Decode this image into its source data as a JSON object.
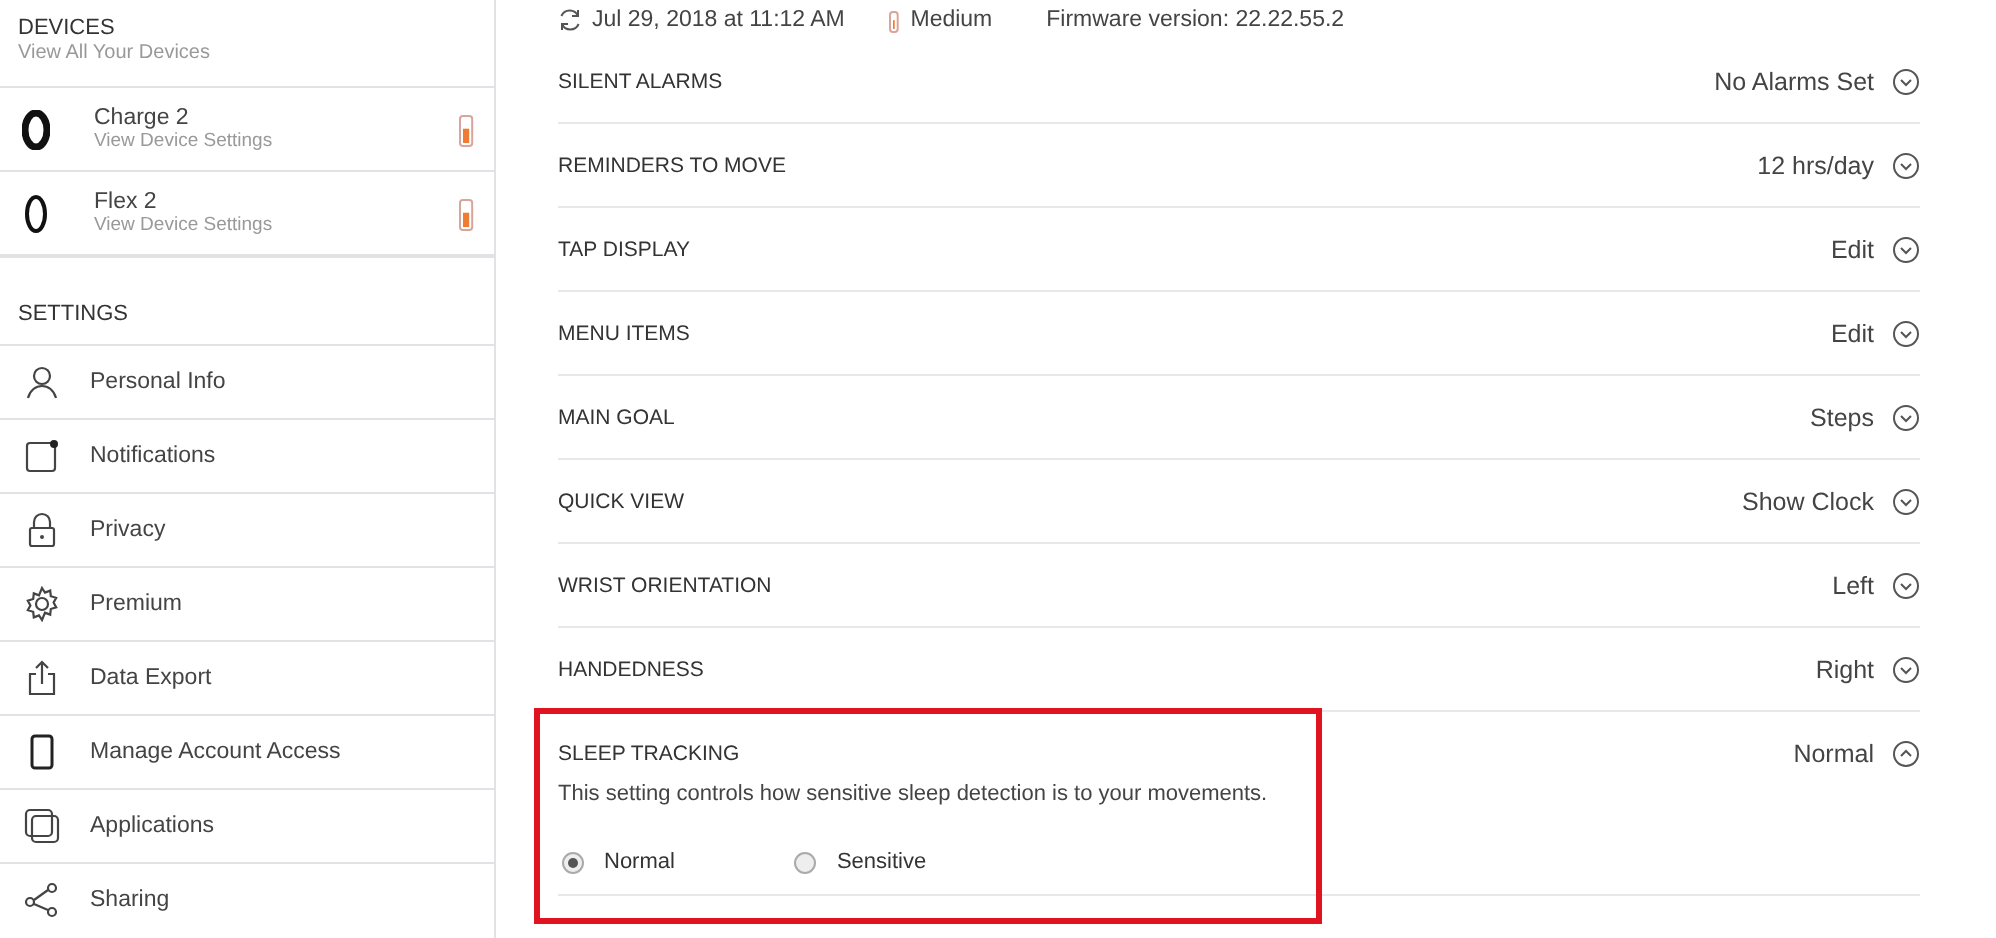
{
  "sidebar": {
    "devices_title": "DEVICES",
    "devices_subtitle": "View All Your Devices",
    "devices": [
      {
        "name": "Charge 2",
        "link": "View Device Settings"
      },
      {
        "name": "Flex 2",
        "link": "View Device Settings"
      }
    ],
    "settings_title": "SETTINGS",
    "items": [
      {
        "label": "Personal Info"
      },
      {
        "label": "Notifications"
      },
      {
        "label": "Privacy"
      },
      {
        "label": "Premium"
      },
      {
        "label": "Data Export"
      },
      {
        "label": "Manage Account Access"
      },
      {
        "label": "Applications"
      },
      {
        "label": "Sharing"
      }
    ]
  },
  "status": {
    "sync": "Jul 29, 2018 at 11:12 AM",
    "battery": {
      "label": "Medium"
    },
    "firmware": "Firmware version: 22.22.55.2"
  },
  "settings": [
    {
      "label": "SILENT ALARMS",
      "value": "No Alarms Set",
      "expanded": false
    },
    {
      "label": "REMINDERS TO MOVE",
      "value": "12 hrs/day",
      "expanded": false
    },
    {
      "label": "TAP DISPLAY",
      "value": "Edit",
      "expanded": false
    },
    {
      "label": "MENU ITEMS",
      "value": "Edit",
      "expanded": false
    },
    {
      "label": "MAIN GOAL",
      "value": "Steps",
      "expanded": false
    },
    {
      "label": "QUICK VIEW",
      "value": "Show Clock",
      "expanded": false
    },
    {
      "label": "WRIST ORIENTATION",
      "value": "Left",
      "expanded": false
    },
    {
      "label": "HANDEDNESS",
      "value": "Right",
      "expanded": false
    },
    {
      "label": "SLEEP TRACKING",
      "value": "Normal",
      "expanded": true,
      "highlighted": true,
      "description": "This setting controls how sensitive sleep detection is to your movements.",
      "options": [
        {
          "label": "Normal",
          "selected": true
        },
        {
          "label": "Sensitive",
          "selected": false
        }
      ]
    }
  ]
}
